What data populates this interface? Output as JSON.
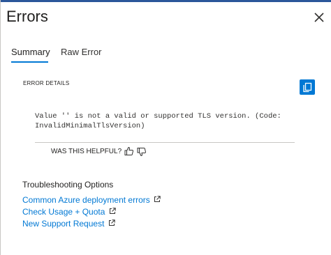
{
  "dialog": {
    "title": "Errors"
  },
  "tabs": [
    {
      "label": "Summary",
      "selected": true
    },
    {
      "label": "Raw Error",
      "selected": false
    }
  ],
  "error_details": {
    "label": "ERROR DETAILS",
    "message_line1": "Value '' is not a valid or supported TLS version. (Code:",
    "message_line2": "InvalidMinimalTlsVersion)",
    "copy_icon": "copy-icon"
  },
  "feedback": {
    "prompt": "WAS THIS HELPFUL?",
    "thumbs_up_icon": "thumbs-up-icon",
    "thumbs_down_icon": "thumbs-down-icon"
  },
  "troubleshooting": {
    "heading": "Troubleshooting Options",
    "links": [
      {
        "label": "Common Azure deployment errors",
        "icon": "external-link-icon"
      },
      {
        "label": "Check Usage + Quota",
        "icon": "external-link-icon"
      },
      {
        "label": "New Support Request",
        "icon": "external-link-icon"
      }
    ]
  },
  "colors": {
    "accent": "#0078d4",
    "text": "#323130",
    "divider": "#c8c6c4",
    "topbar": "#2b579a"
  }
}
